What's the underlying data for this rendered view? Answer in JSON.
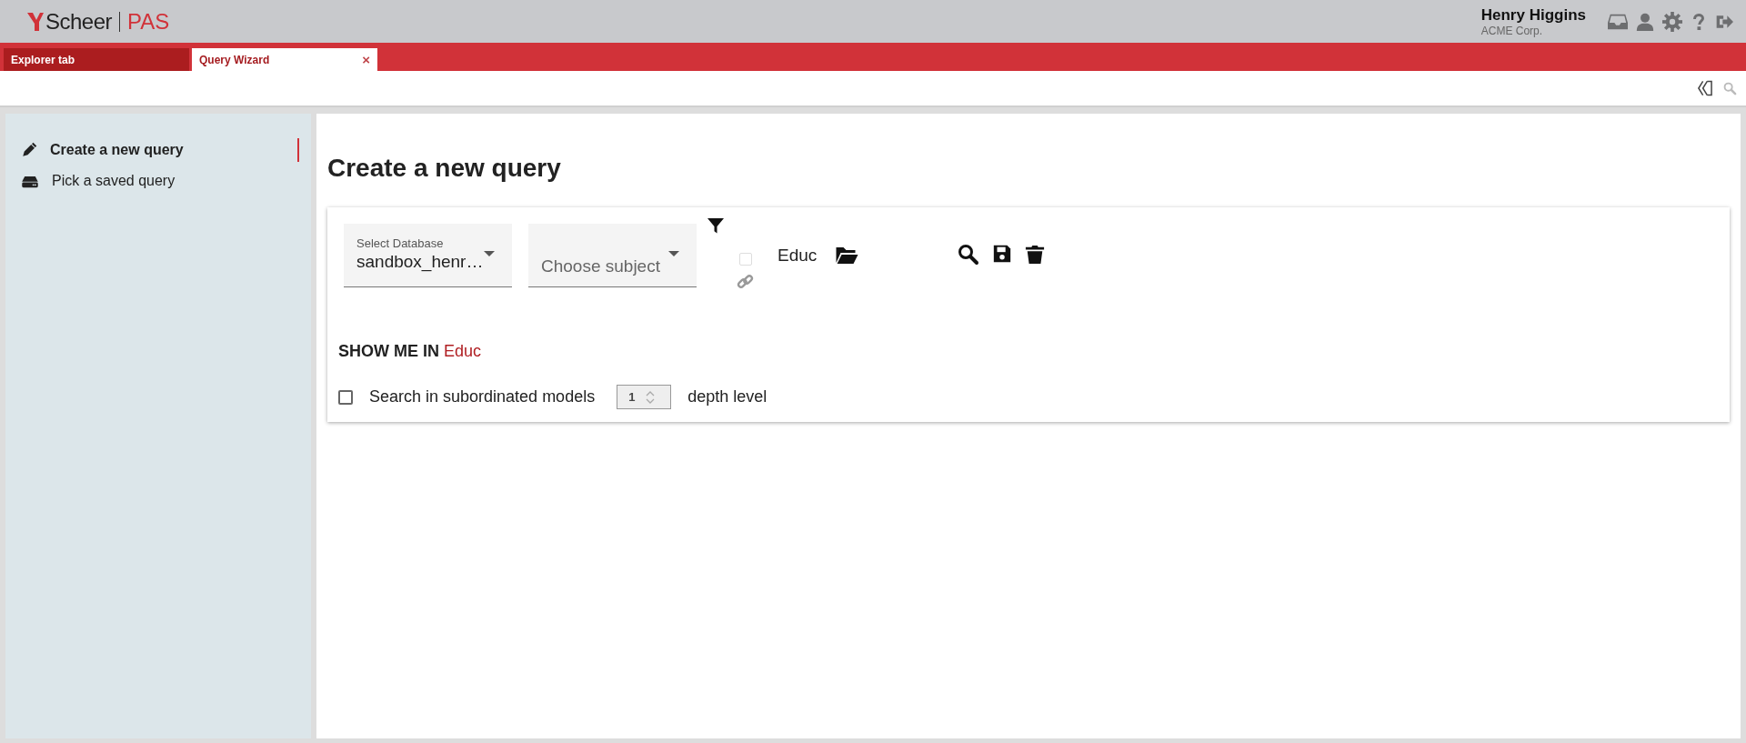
{
  "header": {
    "logo_brand": "Scheer",
    "logo_product": "PAS",
    "user_name": "Henry Higgins",
    "company": "ACME Corp."
  },
  "tabs": [
    {
      "label": "Explorer tab",
      "selected": false
    },
    {
      "label": "Query Wizard",
      "selected": true,
      "close_glyph": "×"
    }
  ],
  "sidebar": {
    "items": [
      {
        "label": "Create a new query",
        "kind": "pencil",
        "selected": true
      },
      {
        "label": "Pick a saved query",
        "kind": "drive",
        "selected": false
      }
    ]
  },
  "main": {
    "title": "Create a new query",
    "database_field": {
      "label": "Select Database",
      "value": "sandbox_henr…"
    },
    "subject_field": {
      "placeholder": "Choose subject"
    },
    "link_checkbox": {
      "checked": false,
      "disabled": true
    },
    "model": "Educ",
    "show_me_in": {
      "label": "SHOW ME IN",
      "target": "Educ"
    },
    "subordinated": {
      "checked": false,
      "label": "Search in subordinated models",
      "depth": "1",
      "depth_label": "depth level"
    }
  }
}
